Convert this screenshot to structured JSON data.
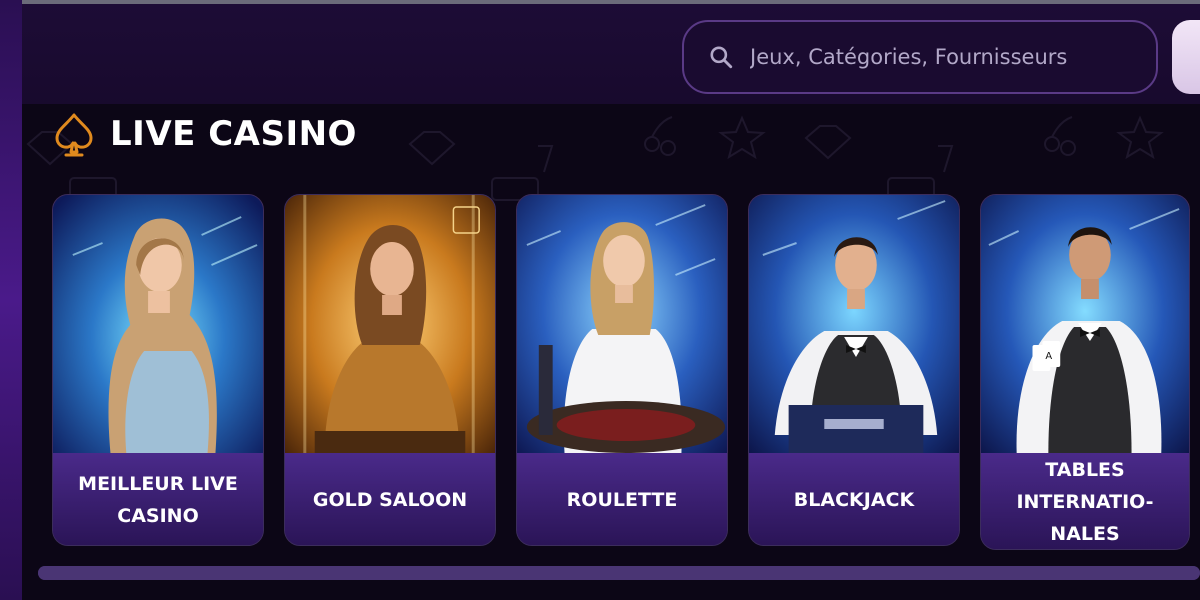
{
  "colors": {
    "background": "#150826",
    "accent": "#e08a1e",
    "card": "#4a2a8a"
  },
  "search": {
    "placeholder": "Jeux, Catégories, Fournisseurs",
    "icon": "search-icon"
  },
  "section": {
    "title": "LIVE CASINO",
    "icon": "spade-icon"
  },
  "games": [
    {
      "label": "MEILLEUR LIVE CASINO"
    },
    {
      "label": "GOLD SALOON"
    },
    {
      "label": "ROULETTE"
    },
    {
      "label": "BLACKJACK"
    },
    {
      "label": "TABLES INTERNATIO-NALES"
    }
  ]
}
